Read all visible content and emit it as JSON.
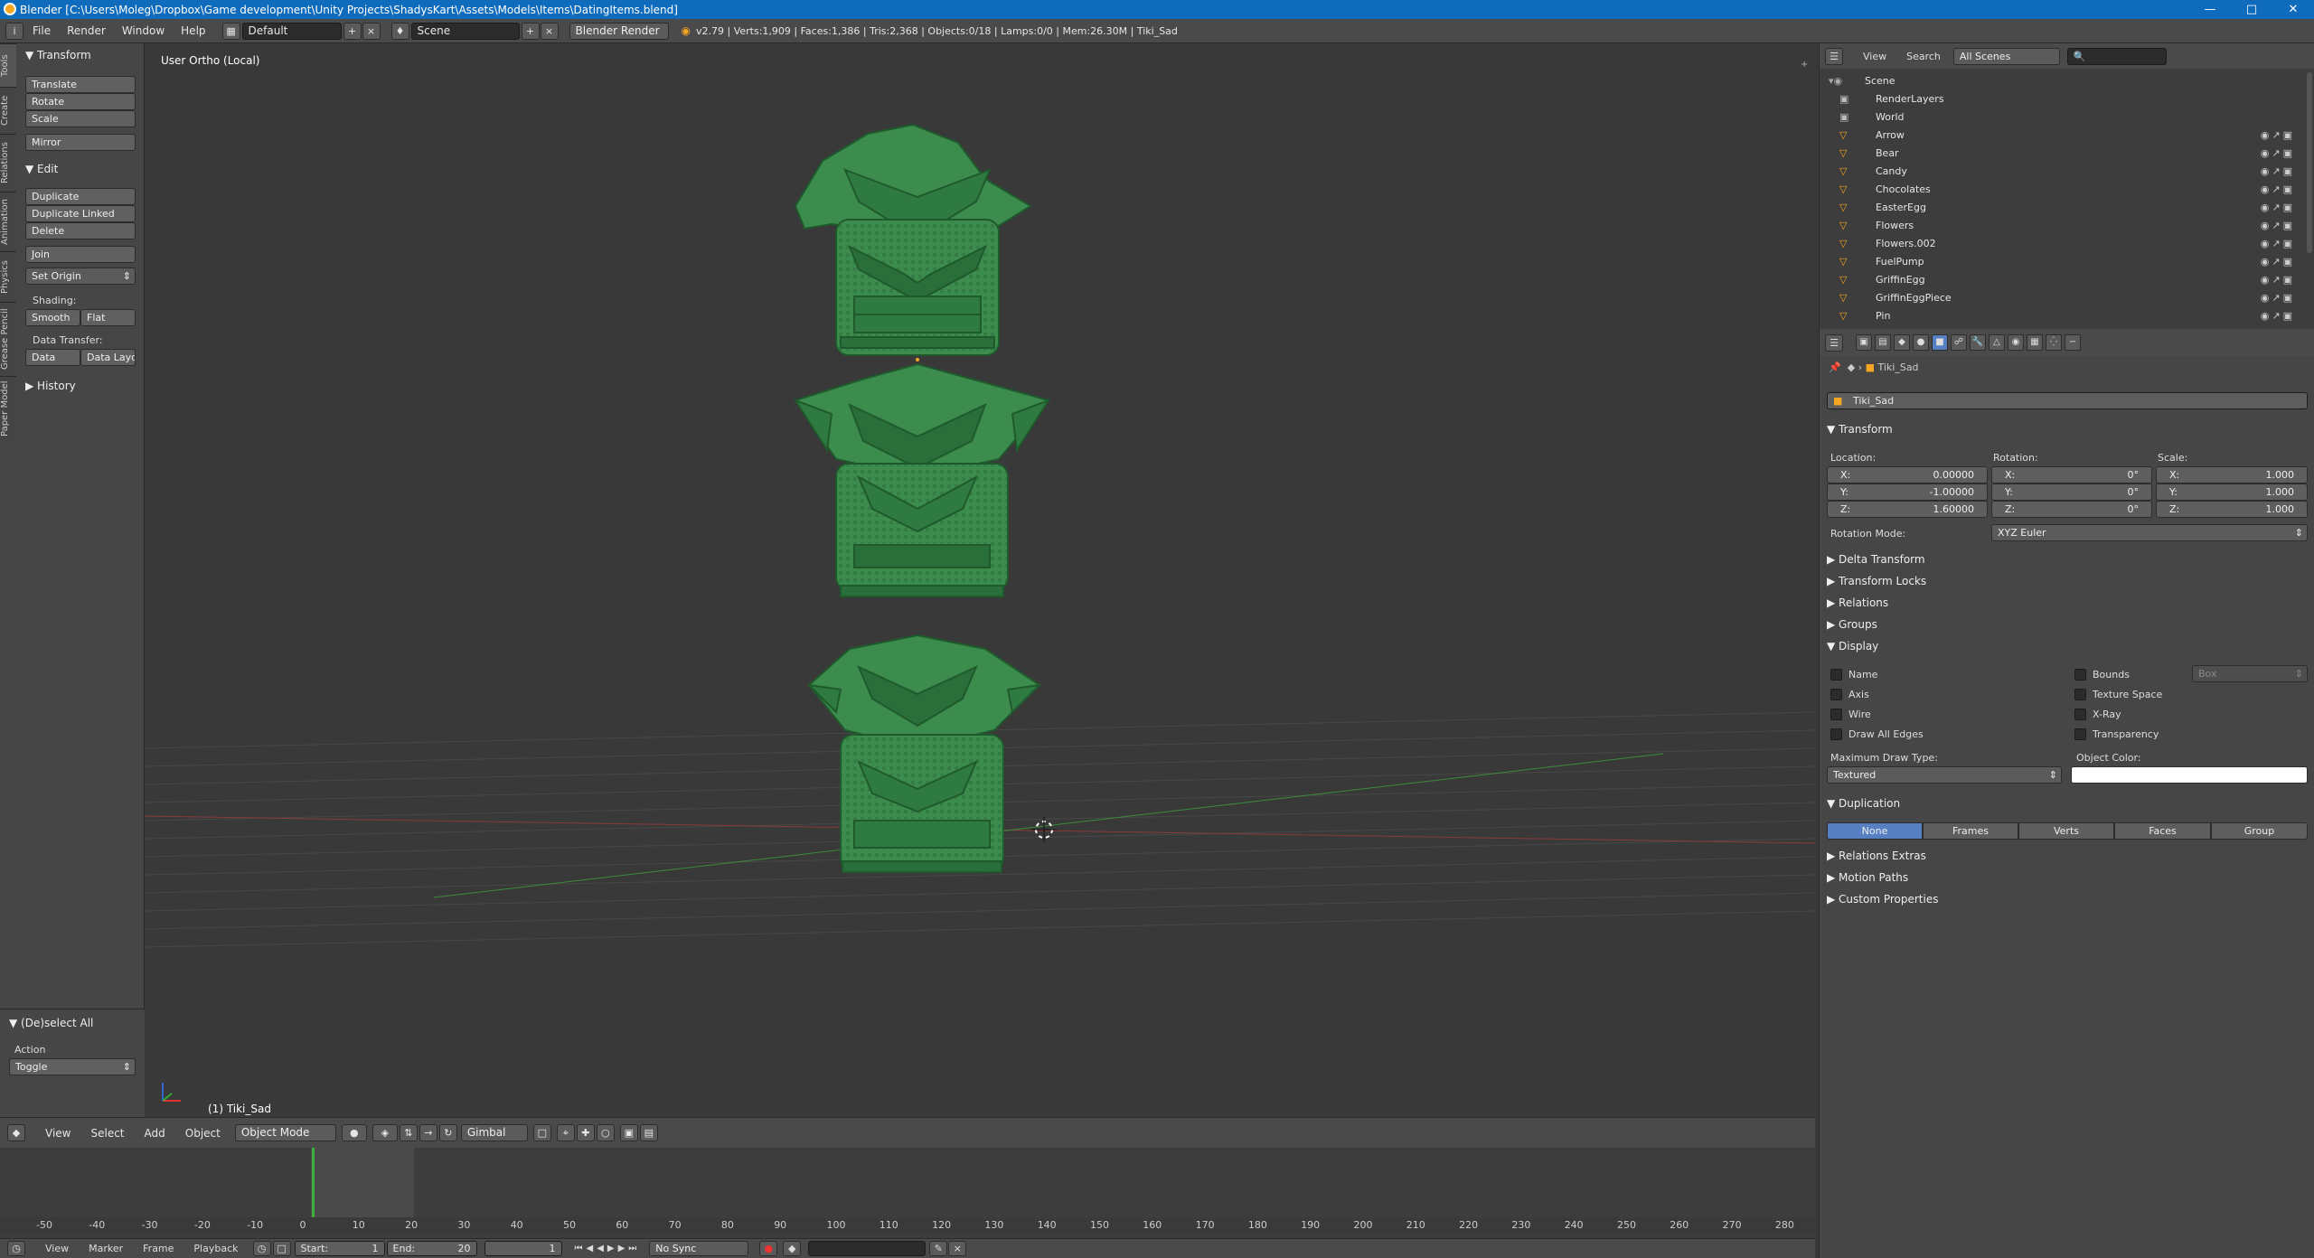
{
  "title_bar": {
    "text": "Blender [C:\\Users\\Moleg\\Dropbox\\Game development\\Unity Projects\\ShadysKart\\Assets\\Models\\Items\\DatingItems.blend]"
  },
  "info_header": {
    "menus": [
      "File",
      "Render",
      "Window",
      "Help"
    ],
    "layout": "Default",
    "scene": "Scene",
    "engine": "Blender Render",
    "stats": "v2.79 | Verts:1,909 | Faces:1,386 | Tris:2,368 | Objects:0/18 | Lamps:0/0 | Mem:26.30M | Tiki_Sad"
  },
  "tool_tabs": [
    "Tools",
    "Create",
    "Relations",
    "Animation",
    "Physics",
    "Grease Pencil",
    "Paper Model"
  ],
  "tools_panel": {
    "transform_title": "Transform",
    "translate": "Translate",
    "rotate": "Rotate",
    "scale": "Scale",
    "mirror": "Mirror",
    "edit_title": "Edit",
    "duplicate": "Duplicate",
    "duplicate_linked": "Duplicate Linked",
    "delete": "Delete",
    "join": "Join",
    "set_origin": "Set Origin",
    "shading_label": "Shading:",
    "smooth": "Smooth",
    "flat": "Flat",
    "data_transfer_label": "Data Transfer:",
    "data": "Data",
    "data_layout": "Data Layo",
    "history_title": "History"
  },
  "operator_panel": {
    "title": "(De)select All",
    "action_label": "Action",
    "action_value": "Toggle"
  },
  "viewport": {
    "view_label": "User Ortho (Local)",
    "object_label": "(1) Tiki_Sad"
  },
  "view3d_header": {
    "menus": [
      "View",
      "Select",
      "Add",
      "Object"
    ],
    "mode": "Object Mode",
    "orientation": "Gimbal"
  },
  "timeline": {
    "ticks": [
      "-50",
      "-40",
      "-30",
      "-20",
      "-10",
      "0",
      "10",
      "20",
      "30",
      "40",
      "50",
      "60",
      "70",
      "80",
      "90",
      "100",
      "110",
      "120",
      "130",
      "140",
      "150",
      "160",
      "170",
      "180",
      "190",
      "200",
      "210",
      "220",
      "230",
      "240",
      "250",
      "260",
      "270",
      "280"
    ],
    "menus": [
      "View",
      "Marker",
      "Frame",
      "Playback"
    ],
    "start_label": "Start:",
    "start_value": "1",
    "end_label": "End:",
    "end_value": "20",
    "current": "1",
    "sync": "No Sync"
  },
  "outliner": {
    "menus": [
      "View",
      "Search"
    ],
    "filter": "All Scenes",
    "items": [
      "Scene",
      "RenderLayers",
      "World",
      "Arrow",
      "Bear",
      "Candy",
      "Chocolates",
      "EasterEgg",
      "Flowers",
      "Flowers.002",
      "FuelPump",
      "GriffinEgg",
      "GriffinEggPiece",
      "Pin"
    ]
  },
  "properties": {
    "context_object": "Tiki_Sad",
    "object_name": "Tiki_Sad",
    "transform_title": "Transform",
    "location_label": "Location:",
    "rotation_label": "Rotation:",
    "scale_label": "Scale:",
    "loc": {
      "x": "0.00000",
      "y": "-1.00000",
      "z": "1.60000"
    },
    "rot": {
      "x": "0°",
      "y": "0°",
      "z": "0°"
    },
    "scl": {
      "x": "1.000",
      "y": "1.000",
      "z": "1.000"
    },
    "axis_x": "X:",
    "axis_y": "Y:",
    "axis_z": "Z:",
    "rotation_mode_label": "Rotation Mode:",
    "rotation_mode": "XYZ Euler",
    "sections": [
      "Delta Transform",
      "Transform Locks",
      "Relations",
      "Groups"
    ],
    "display_title": "Display",
    "display_left": [
      "Name",
      "Axis",
      "Wire",
      "Draw All Edges"
    ],
    "display_right": [
      "Bounds",
      "Texture Space",
      "X-Ray",
      "Transparency"
    ],
    "bounds_type": "Box",
    "max_draw_label": "Maximum Draw Type:",
    "max_draw_value": "Textured",
    "object_color_label": "Object Color:",
    "duplication_title": "Duplication",
    "duplication_options": [
      "None",
      "Frames",
      "Verts",
      "Faces",
      "Group"
    ],
    "bottom_sections": [
      "Relations Extras",
      "Motion Paths",
      "Custom Properties"
    ]
  },
  "colors": {
    "tiki_green": "#3c8c4e",
    "tiki_dark": "#1f5a2c",
    "accent_blue": "#5680c2",
    "title_blue": "#0f6cbd"
  }
}
